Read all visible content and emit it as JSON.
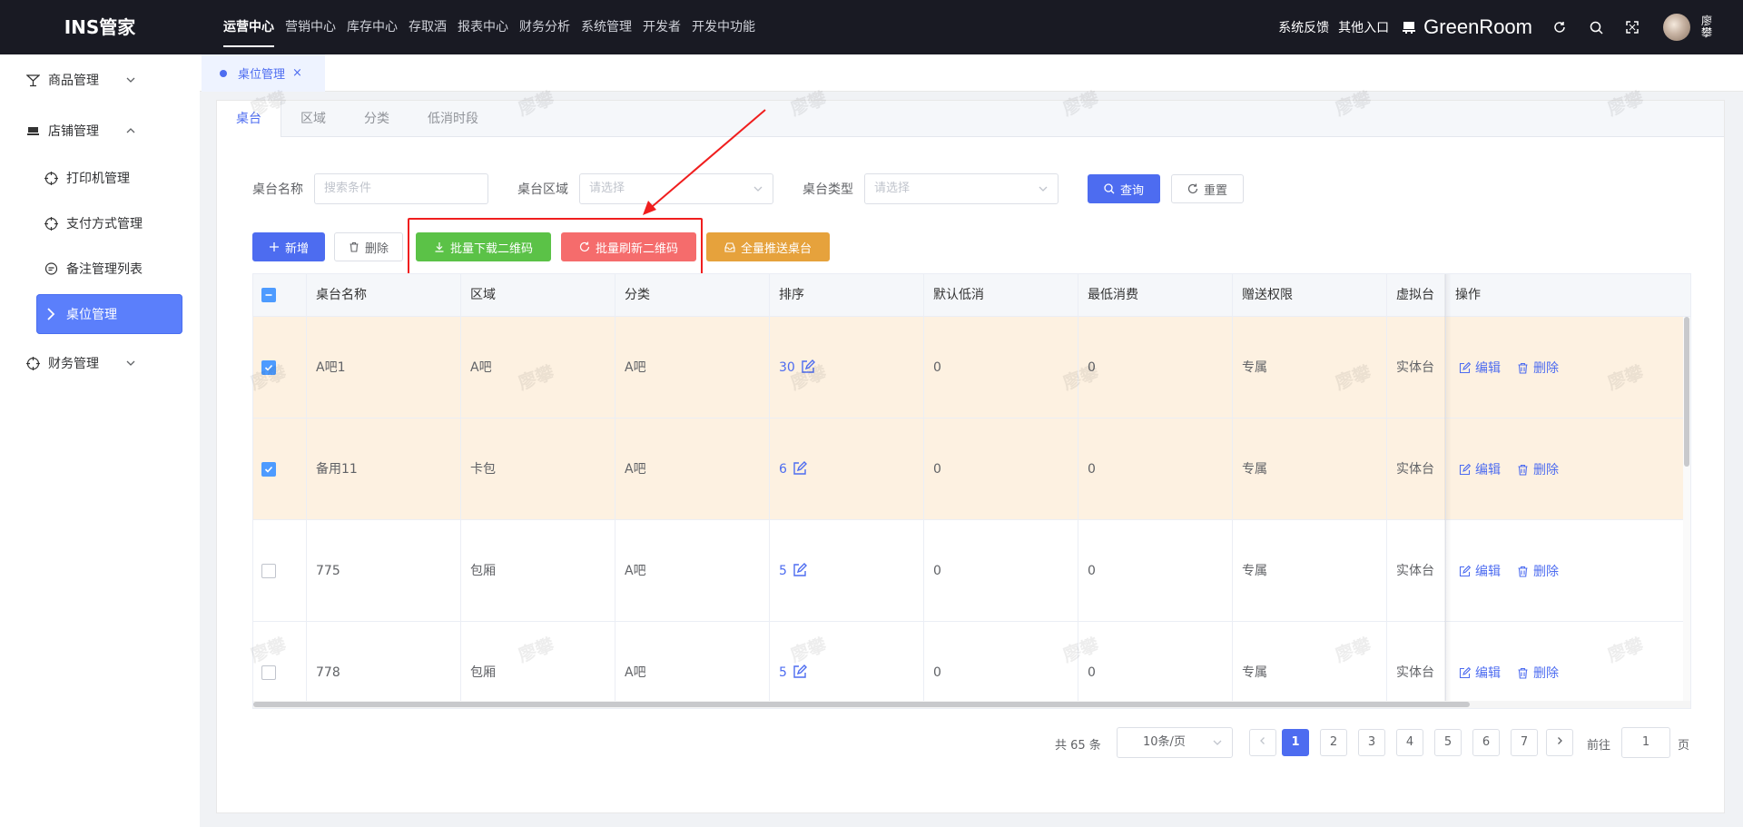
{
  "app": {
    "logo": "INS管家"
  },
  "topnav": [
    {
      "label": "运营中心",
      "active": true
    },
    {
      "label": "营销中心"
    },
    {
      "label": "库存中心"
    },
    {
      "label": "存取酒"
    },
    {
      "label": "报表中心"
    },
    {
      "label": "财务分析"
    },
    {
      "label": "系统管理"
    },
    {
      "label": "开发者"
    },
    {
      "label": "开发中功能"
    }
  ],
  "header": {
    "feedback": "系统反馈",
    "other_entry": "其他入口",
    "store_name": "GreenRoom",
    "user_name": "廖攀"
  },
  "sidebar": {
    "product": "商品管理",
    "store": "店铺管理",
    "sub": [
      "打印机管理",
      "支付方式管理",
      "备注管理列表",
      "桌位管理"
    ],
    "finance": "财务管理"
  },
  "page_tab": {
    "label": "桌位管理",
    "close": "×"
  },
  "subtabs": [
    "桌台",
    "区域",
    "分类",
    "低消时段"
  ],
  "filters": {
    "name_label": "桌台名称",
    "name_placeholder": "搜索条件",
    "area_label": "桌台区域",
    "area_placeholder": "请选择",
    "type_label": "桌台类型",
    "type_placeholder": "请选择",
    "query": "查询",
    "reset": "重置"
  },
  "toolbar": {
    "add": "新增",
    "delete": "删除",
    "batch_download": "批量下载二维码",
    "batch_refresh": "批量刷新二维码",
    "push_all": "全量推送桌台"
  },
  "table": {
    "headers": [
      "桌台名称",
      "区域",
      "分类",
      "排序",
      "默认低消",
      "最低消费",
      "赠送权限",
      "虚拟台",
      "操作"
    ],
    "rows": [
      {
        "name": "A吧1",
        "area": "A吧",
        "category": "A吧",
        "sort": "30",
        "default_min": "0",
        "min_spend": "0",
        "gift": "专属",
        "virtual": "实体台",
        "checked": true
      },
      {
        "name": "备用11",
        "area": "卡包",
        "category": "A吧",
        "sort": "6",
        "default_min": "0",
        "min_spend": "0",
        "gift": "专属",
        "virtual": "实体台",
        "checked": true
      },
      {
        "name": "775",
        "area": "包厢",
        "category": "A吧",
        "sort": "5",
        "default_min": "0",
        "min_spend": "0",
        "gift": "专属",
        "virtual": "实体台",
        "checked": false
      },
      {
        "name": "778",
        "area": "包厢",
        "category": "A吧",
        "sort": "5",
        "default_min": "0",
        "min_spend": "0",
        "gift": "专属",
        "virtual": "实体台",
        "checked": false
      }
    ],
    "edit": "编辑",
    "remove": "删除"
  },
  "pagination": {
    "total": "共 65 条",
    "page_size": "10条/页",
    "pages": [
      "1",
      "2",
      "3",
      "4",
      "5",
      "6",
      "7"
    ],
    "current": "1",
    "goto_label": "前往",
    "goto_value": "1",
    "page_unit": "页"
  },
  "watermark": "廖攀",
  "colors": {
    "primary": "#4d6cf0",
    "success": "#5bc247",
    "danger": "#f56c6c",
    "warning": "#e6a23c",
    "highlight": "#f01e1e"
  }
}
